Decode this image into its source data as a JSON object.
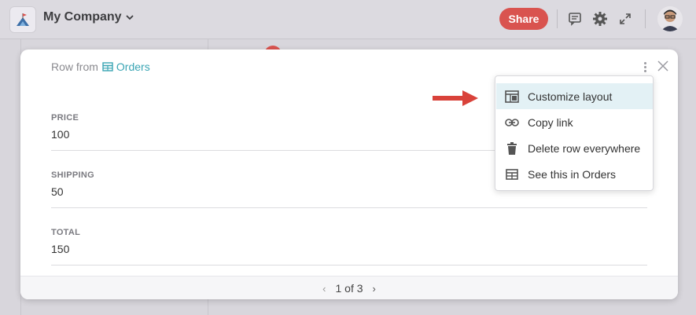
{
  "topbar": {
    "company_name": "My Company",
    "share_label": "Share",
    "icons": [
      "comment-icon",
      "gear-icon",
      "expand-icon"
    ]
  },
  "card": {
    "row_from_prefix": "Row from",
    "table_name": "Orders",
    "fields": [
      {
        "label": "PRICE",
        "value": "100"
      },
      {
        "label": "SHIPPING",
        "value": "50"
      },
      {
        "label": "TOTAL",
        "value": "150"
      }
    ],
    "pager": {
      "text": "1 of 3"
    }
  },
  "menu": {
    "items": [
      {
        "label": "Customize layout",
        "icon": "layout-icon",
        "active": true
      },
      {
        "label": "Copy link",
        "icon": "link-icon",
        "active": false
      },
      {
        "label": "Delete row everywhere",
        "icon": "trash-icon",
        "active": false
      },
      {
        "label": "See this in Orders",
        "icon": "table-icon",
        "active": false
      }
    ]
  },
  "colors": {
    "accent": "#3aa5b4",
    "share": "#d9534f",
    "arrow": "#d9423a",
    "menu_active": "#e3f1f5"
  }
}
